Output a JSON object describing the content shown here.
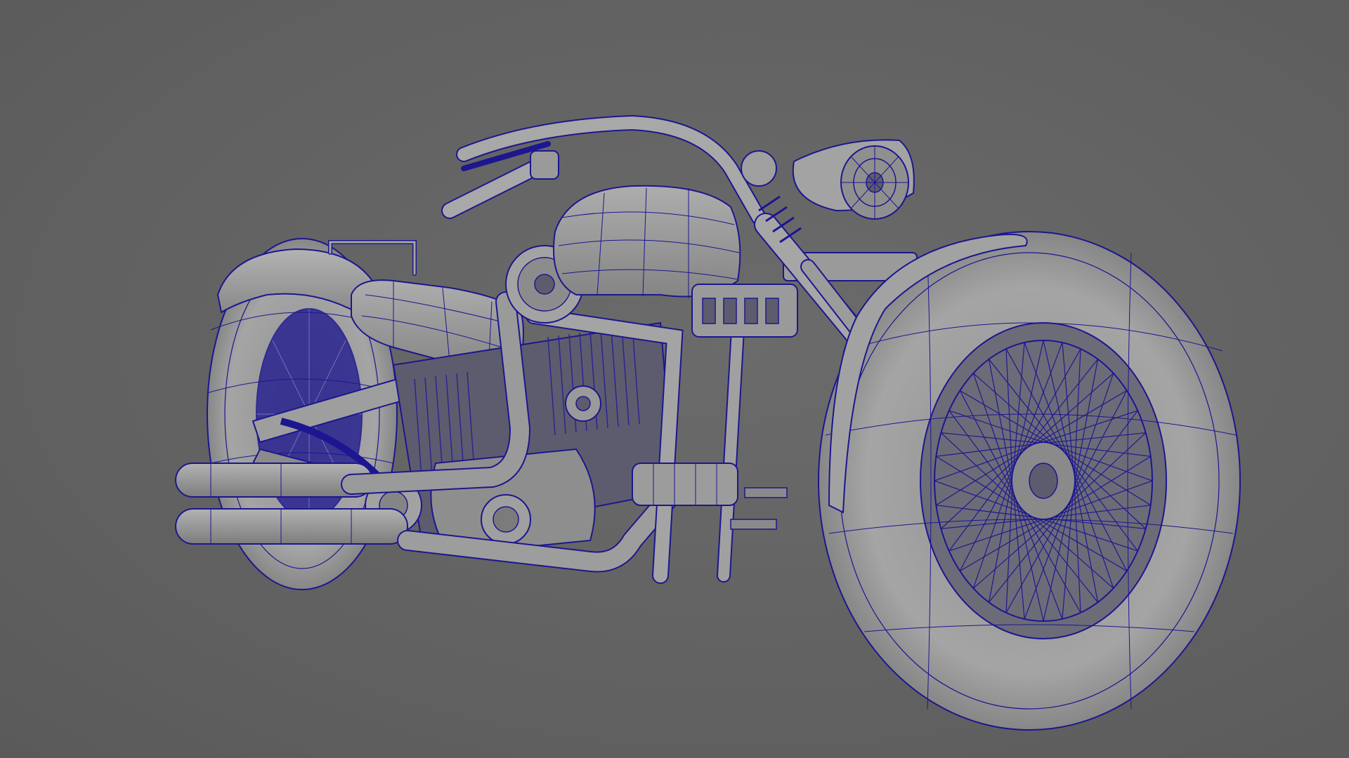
{
  "viewport": {
    "background_color": "#626262",
    "surface_color": "#9a9a9a",
    "wire_color": "#1c1690",
    "shade_color": "#6c6c74",
    "subject": "motorcycle-wireframe-model"
  }
}
